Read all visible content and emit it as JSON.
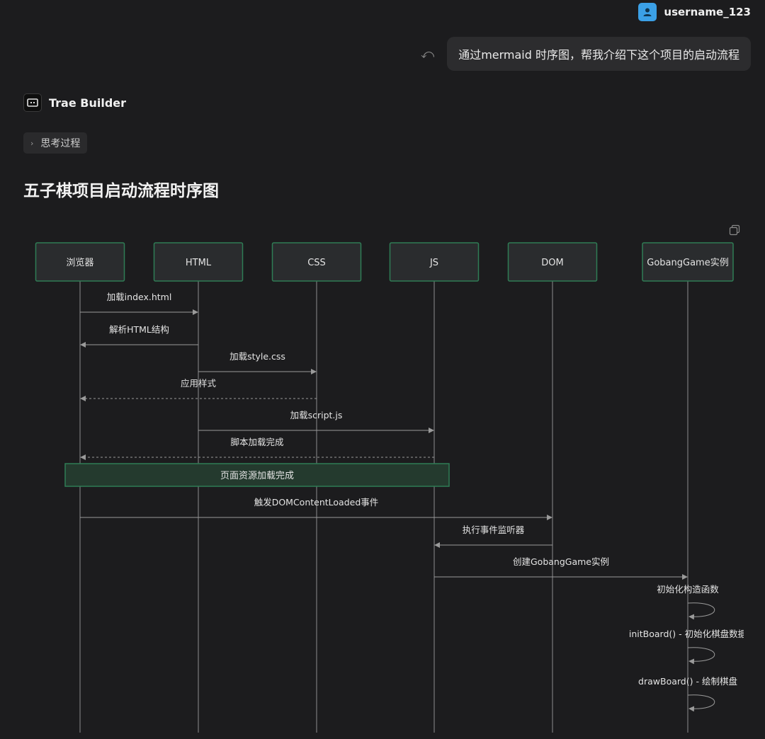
{
  "user": {
    "name": "username_123",
    "avatar_icon": "user-avatar-icon"
  },
  "message": {
    "text": "通过mermaid 时序图，帮我介绍下这个项目的启动流程",
    "undo_icon": "undo-icon"
  },
  "assistant": {
    "name": "Trae Builder",
    "logo_icon": "trae-logo-icon",
    "thinking_label": "思考过程"
  },
  "diagram_title": "五子棋项目启动流程时序图",
  "colors": {
    "background": "#1c1c1e",
    "participant_fill": "#2a2c2e",
    "participant_border": "#2f7d55",
    "note_fill": "#243a2e",
    "line": "#9a9a9a",
    "accent": "#3ba0e6"
  },
  "chart_data": {
    "type": "sequence",
    "participants": [
      "浏览器",
      "HTML",
      "CSS",
      "JS",
      "DOM",
      "GobangGame实例"
    ],
    "messages": [
      {
        "from": 0,
        "to": 1,
        "label": "加载index.html",
        "style": "solid"
      },
      {
        "from": 1,
        "to": 0,
        "label": "解析HTML结构",
        "style": "solid"
      },
      {
        "from": 1,
        "to": 2,
        "label": "加载style.css",
        "style": "solid"
      },
      {
        "from": 2,
        "to": 0,
        "label": "应用样式",
        "style": "dashed"
      },
      {
        "from": 1,
        "to": 3,
        "label": "加载script.js",
        "style": "solid"
      },
      {
        "from": 3,
        "to": 0,
        "label": "脚本加载完成",
        "style": "dashed"
      },
      {
        "note": "页面资源加载完成",
        "from": 0,
        "to": 3
      },
      {
        "from": 0,
        "to": 4,
        "label": "触发DOMContentLoaded事件",
        "style": "solid"
      },
      {
        "from": 4,
        "to": 3,
        "label": "执行事件监听器",
        "style": "solid"
      },
      {
        "from": 3,
        "to": 5,
        "label": "创建GobangGame实例",
        "style": "solid"
      },
      {
        "from": 5,
        "to": 5,
        "label": "初始化构造函数",
        "style": "solid"
      },
      {
        "from": 5,
        "to": 5,
        "label": "initBoard() - 初始化棋盘数据",
        "style": "solid"
      },
      {
        "from": 5,
        "to": 5,
        "label": "drawBoard() - 绘制棋盘",
        "style": "solid"
      }
    ]
  }
}
